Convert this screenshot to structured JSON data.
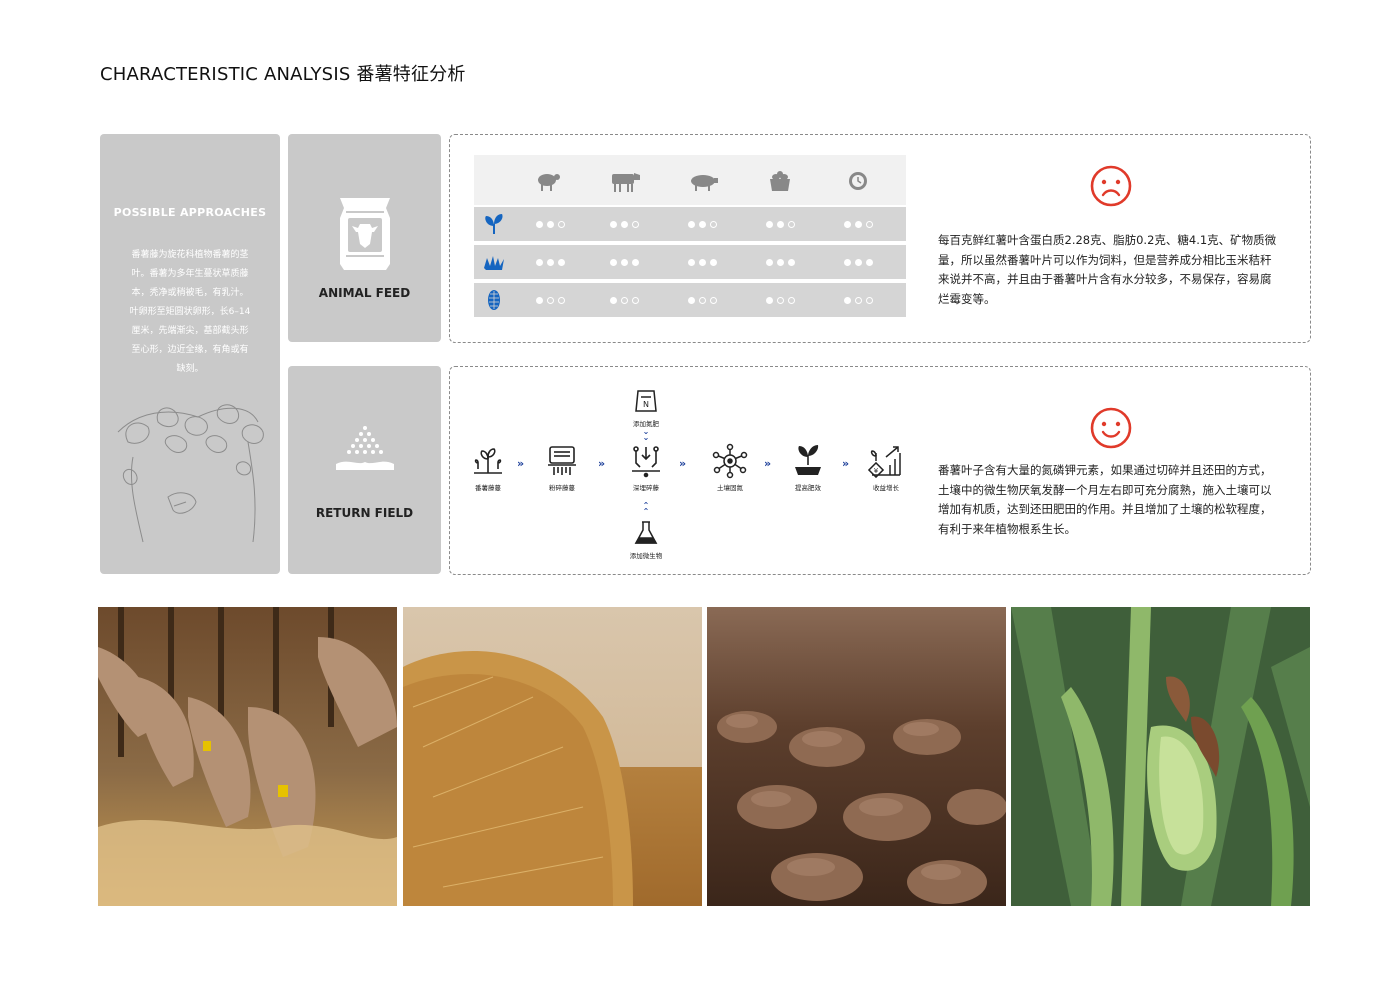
{
  "header": {
    "title": "CHARACTERISTIC ANALYSIS 番薯特征分析"
  },
  "approach": {
    "heading": "POSSIBLE APPROACHES",
    "lines": [
      "番薯藤为旋花科植物番薯的茎",
      "叶。番薯为多年生蔓状草质藤",
      "本，秃净或稍被毛，有乳汁。",
      "叶卵形至矩圆状卵形，长6–14",
      "厘米，先端渐尖，基部截头形",
      "至心形，边近全缘，有角或有",
      "缺刻。"
    ]
  },
  "cards": {
    "feed_label": "ANIMAL FEED",
    "field_label": "RETURN FIELD"
  },
  "feed_matrix": {
    "columns": [
      "sheep-icon",
      "cow-icon",
      "pig-icon",
      "poultry-icon",
      "clock-icon"
    ],
    "rows": [
      {
        "icon": "sprout-icon",
        "levels": [
          2,
          2,
          2,
          2,
          2
        ]
      },
      {
        "icon": "grass-icon",
        "levels": [
          3,
          3,
          3,
          3,
          3
        ]
      },
      {
        "icon": "corn-icon",
        "levels": [
          1,
          1,
          1,
          1,
          1
        ]
      }
    ],
    "accent": "#1565c0"
  },
  "feed_panel": {
    "face": "sad",
    "text": "每百克鲜红薯叶含蛋白质2.28克、脂肪0.2克、糖4.1克、矿物质微量，所以虽然番薯叶片可以作为饲料，但是营养成分相比玉米秸秆来说并不高，并且由于番薯叶片含有水分较多，不易保存，容易腐烂霉变等。",
    "face_color": "#e03a2a"
  },
  "field_panel": {
    "face": "happy",
    "text": "番薯叶子含有大量的氮磷钾元素，如果通过切碎并且还田的方式，土壤中的微生物厌氧发酵一个月左右即可充分腐熟，施入土壤可以增加有机质，达到还田肥田的作用。并且增加了土壤的松软程度，有利于来年植物根系生长。",
    "face_color": "#e03a2a"
  },
  "process": {
    "steps": [
      "番薯藤蔓",
      "粉碎藤蔓",
      "深埋碎藤",
      "土壤固氮",
      "提高肥效",
      "收益增长"
    ],
    "top_step": "添加氮肥",
    "bottom_step": "添加微生物",
    "arrow": "»",
    "arrow_color": "#1c3f9a"
  },
  "photos": [
    "cows-feeding",
    "hay-bale",
    "soil",
    "corn-plant"
  ]
}
